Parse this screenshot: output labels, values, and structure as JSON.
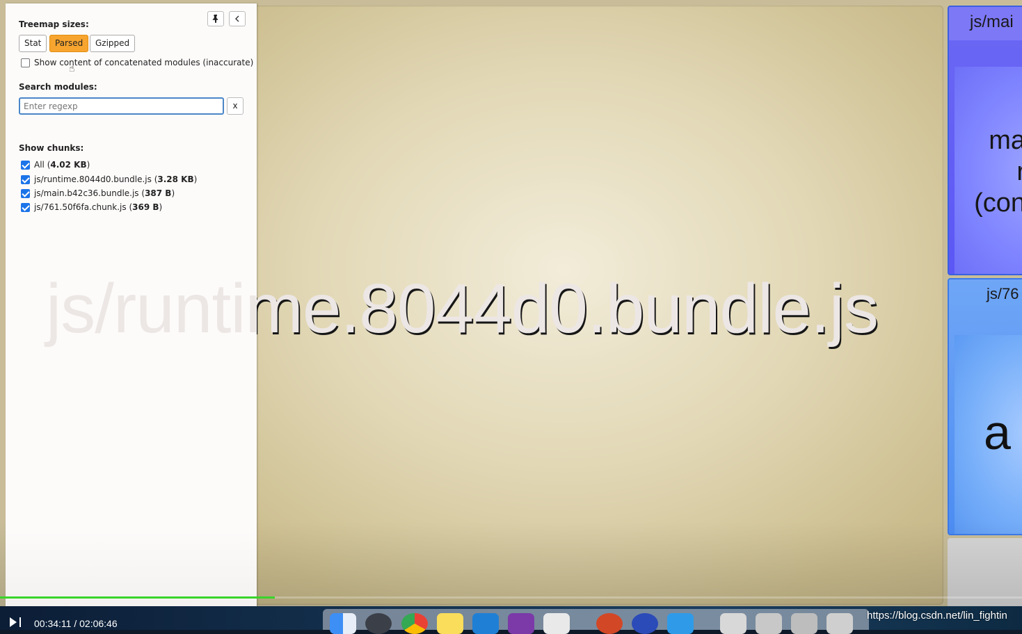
{
  "sidebar": {
    "pin_icon": "pin-icon",
    "collapse_icon": "chevron-left-icon",
    "treemap_sizes_title": "Treemap sizes:",
    "size_buttons": [
      "Stat",
      "Parsed",
      "Gzipped"
    ],
    "active_size": "Parsed",
    "concat_label": "Show content of concatenated modules (inaccurate)",
    "search_title": "Search modules:",
    "search_placeholder": "Enter regexp",
    "search_clear": "x",
    "chunks_title": "Show chunks:",
    "chunks": [
      {
        "name": "All",
        "size": "4.02 KB",
        "checked": true
      },
      {
        "name": "js/runtime.8044d0.bundle.js",
        "size": "3.28 KB",
        "checked": true
      },
      {
        "name": "js/main.b42c36.bundle.js",
        "size": "387 B",
        "checked": true
      },
      {
        "name": "js/761.50f6fa.chunk.js",
        "size": "369 B",
        "checked": true
      }
    ]
  },
  "treemap": {
    "runtime_label": "js/runtime.8044d0.bundle.js",
    "main_head": "js/mai",
    "main_big": [
      "ma",
      "r",
      "(con"
    ],
    "chunk_head": "js/76",
    "chunk_big": "a"
  },
  "video": {
    "timecode": "00:34:11 / 02:06:46",
    "progress": 0.269,
    "progress_color": "#39d42a"
  },
  "watermark": "https://blog.csdn.net/lin_fightin",
  "colors": {
    "accent_button": "#f7a52f",
    "checkbox": "#1c74e9",
    "runtime_cell": "#e2d8b6",
    "main_cell": "#6c68f4",
    "chunk_cell": "#4c8cf2"
  }
}
